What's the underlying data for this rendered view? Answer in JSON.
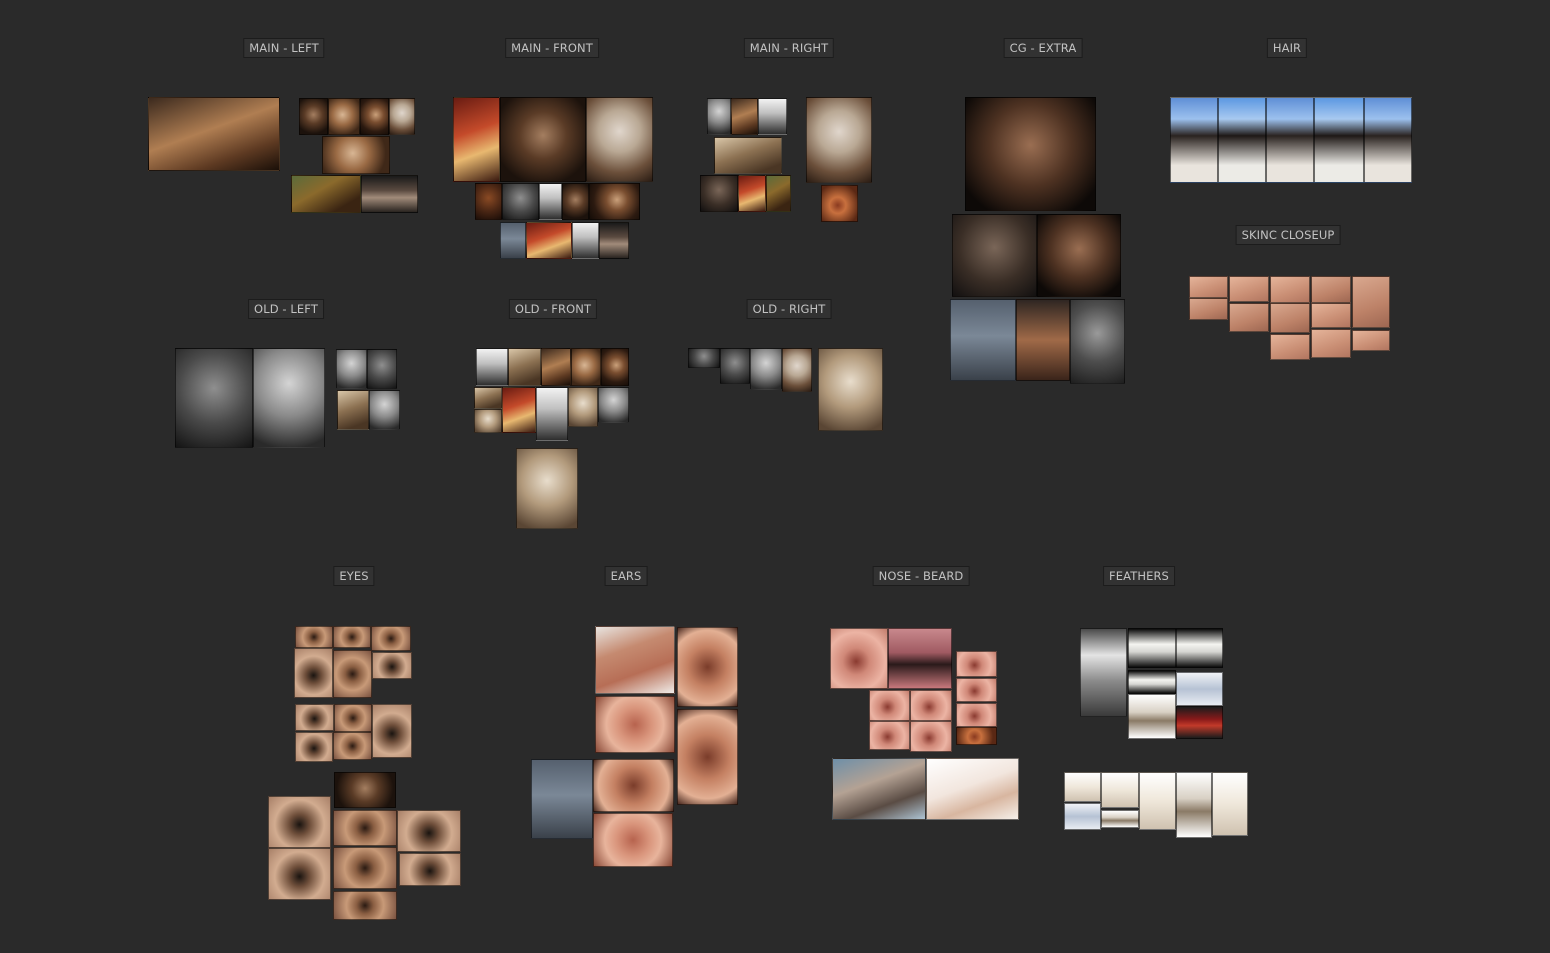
{
  "labels": {
    "main_left": "MAIN - LEFT",
    "main_front": "MAIN - FRONT",
    "main_right": "MAIN - RIGHT",
    "cg_extra": "CG - EXTRA",
    "hair": "HAIR",
    "skinc_closeup": "SKINC CLOSEUP",
    "old_left": "OLD - LEFT",
    "old_front": "OLD - FRONT",
    "old_right": "OLD - RIGHT",
    "eyes": "EYES",
    "ears": "EARS",
    "nose_beard": "NOSE - BEARD",
    "feathers": "FEATHERS"
  },
  "colors": {
    "canvas_background": "#2a2a2a",
    "label_background": "#323232",
    "label_text": "#c2c2c2"
  }
}
